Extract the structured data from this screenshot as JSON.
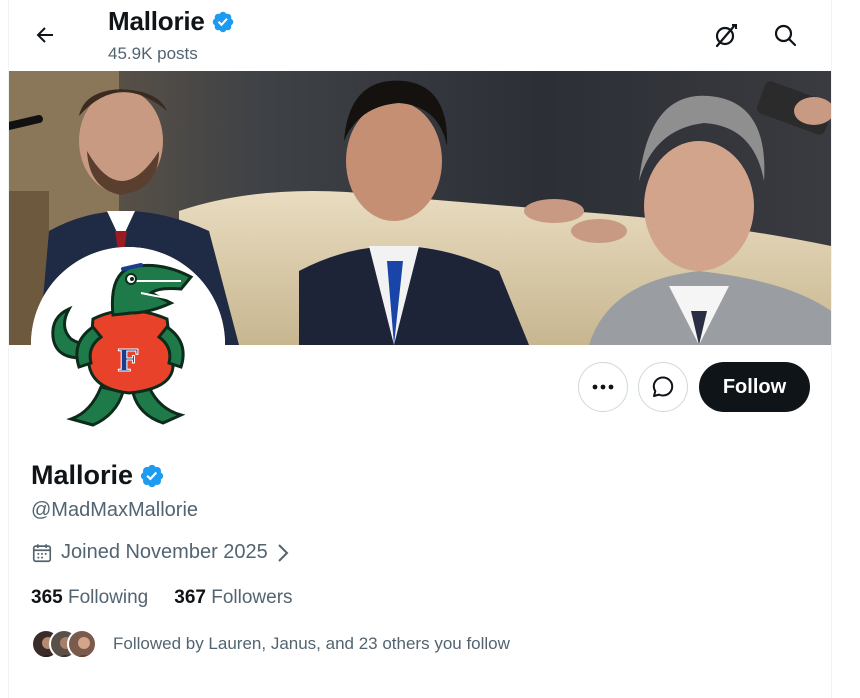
{
  "header": {
    "name": "Mallorie",
    "posts": "45.9K posts"
  },
  "profile": {
    "name": "Mallorie",
    "handle": "@MadMaxMallorie",
    "joined": "Joined November 2025"
  },
  "actions": {
    "follow_label": "Follow"
  },
  "stats": {
    "following_count": "365",
    "following_label": "Following",
    "followers_count": "367",
    "followers_label": "Followers"
  },
  "followed_by": {
    "text": "Followed by Lauren, Janus, and 23 others you follow"
  },
  "colors": {
    "verified": "#1d9bf0",
    "follow_bg": "#0f1419",
    "secondary_text": "#536471",
    "border": "#cfd9de"
  },
  "icons": {
    "back": "arrow-left-icon",
    "grok": "grok-slash-icon",
    "search": "search-icon",
    "verified": "verified-badge-icon",
    "calendar": "calendar-icon",
    "chevron": "chevron-right-icon",
    "more": "more-dots-icon",
    "message": "message-bubble-icon"
  }
}
